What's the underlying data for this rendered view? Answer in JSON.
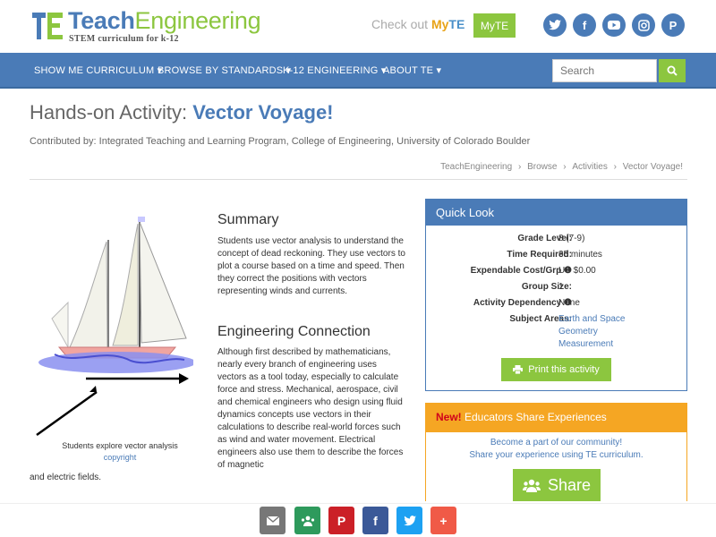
{
  "header": {
    "logo_teach": "Teach",
    "logo_engineering": "Engineering",
    "logo_sub": "STEM curriculum for k-12",
    "checkout_text": "Check out",
    "checkout_my": "My",
    "checkout_te": "TE",
    "myte_button": "MyTE",
    "social_icons": [
      "twitter-icon",
      "facebook-icon",
      "youtube-icon",
      "instagram-icon",
      "pinterest-icon"
    ]
  },
  "nav": {
    "items": [
      {
        "label": "SHOW ME CURRICULUM"
      },
      {
        "label": "BROWSE BY STANDARDS"
      },
      {
        "label": "K-12 ENGINEERING"
      },
      {
        "label": "ABOUT TE"
      }
    ],
    "search_placeholder": "Search"
  },
  "page": {
    "title_prefix": "Hands-on Activity: ",
    "title_name": "Vector Voyage!",
    "contributed": "Contributed by: Integrated Teaching and Learning Program, College of Engineering, University of Colorado Boulder",
    "breadcrumbs": [
      "TeachEngineering",
      "Browse",
      "Activities",
      "Vector Voyage!"
    ]
  },
  "image": {
    "caption": "Students explore vector analysis",
    "copyright": "copyright"
  },
  "summary": {
    "heading": "Summary",
    "text": "Students use vector analysis to understand the concept of dead reckoning. They use vectors to plot a course based on a time and speed. Then they correct the positions with vectors representing winds and currents."
  },
  "engineering": {
    "heading": "Engineering Connection",
    "text": "Although first described by mathematicians, nearly every branch of engineering uses vectors as a tool today, especially to calculate force and stress. Mechanical, aerospace, civil and chemical engineers who design using fluid dynamics concepts use vectors in their calculations to describe real-world forces such as wind and water movement. Electrical engineers also use them to describe the forces of magnetic",
    "text_tail": "and electric fields."
  },
  "quick_look": {
    "heading": "Quick Look",
    "rows": [
      {
        "key": "Grade Level:",
        "value": "8 (7-9)"
      },
      {
        "key": "Time Required:",
        "value": "35 minutes"
      },
      {
        "key": "Expendable Cost/Grp",
        "value": "US $0.00"
      },
      {
        "key": "Group Size:",
        "value": "1"
      },
      {
        "key": "Activity Dependency",
        "value": "None"
      },
      {
        "key": "Subject Areas:",
        "value": "Earth and Space"
      }
    ],
    "subjects_extra": [
      "Geometry",
      "Measurement"
    ],
    "print_button": "Print this activity"
  },
  "share": {
    "new_label": "New!",
    "heading": " Educators Share Experiences",
    "line1": "Become a part of our community!",
    "line2": "Share your experience using TE curriculum.",
    "button": "Share"
  },
  "share_bar": {
    "buttons": [
      "email-icon",
      "classroom-icon",
      "pinterest-icon",
      "facebook-icon",
      "twitter-icon",
      "plus-icon"
    ]
  }
}
